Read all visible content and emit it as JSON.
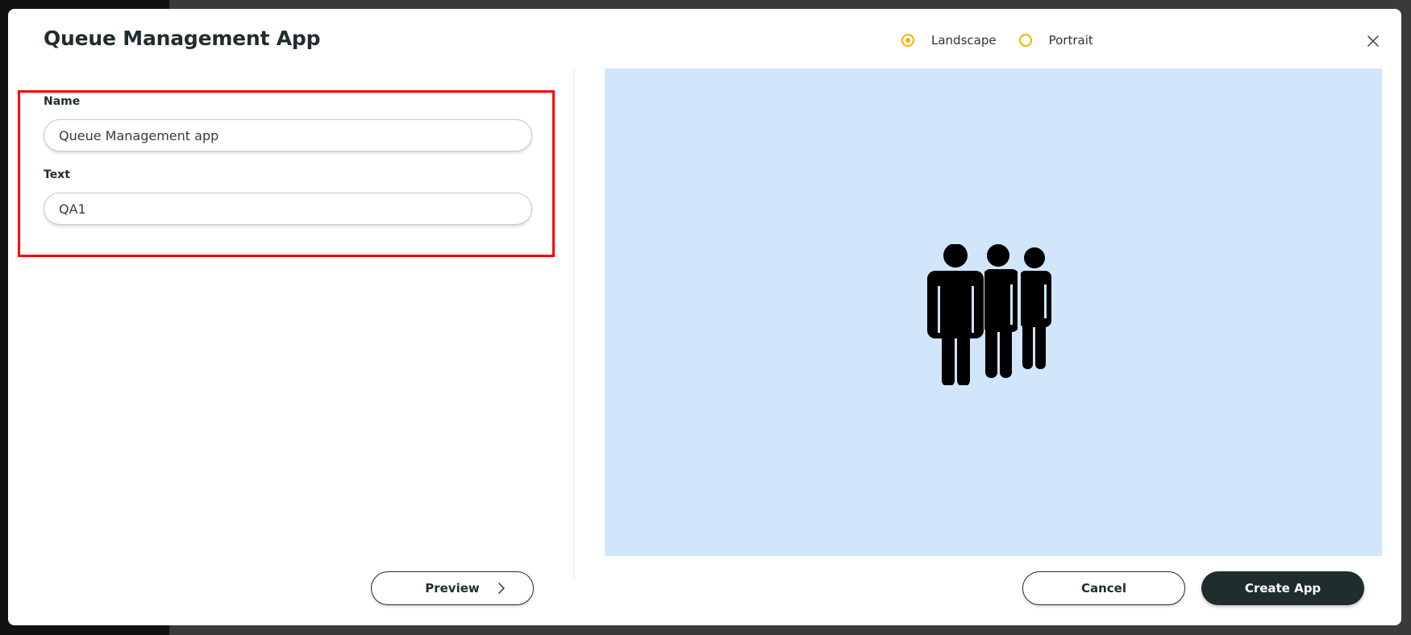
{
  "dialog": {
    "title": "Queue Management App",
    "close_icon": "close-icon"
  },
  "orientation": {
    "options": [
      {
        "label": "Landscape",
        "selected": true
      },
      {
        "label": "Portrait",
        "selected": false
      }
    ],
    "accent_color": "#f0b400"
  },
  "form": {
    "name": {
      "label": "Name",
      "value": "Queue Management app"
    },
    "text": {
      "label": "Text",
      "value": "QA1"
    },
    "highlight_color": "#ff0000"
  },
  "preview": {
    "background_color": "#d1e5fb",
    "icon": "people-queue-icon"
  },
  "footer": {
    "preview_label": "Preview",
    "preview_icon": "chevron-right-icon",
    "cancel_label": "Cancel",
    "create_label": "Create App",
    "primary_color": "#1f2d2d"
  }
}
